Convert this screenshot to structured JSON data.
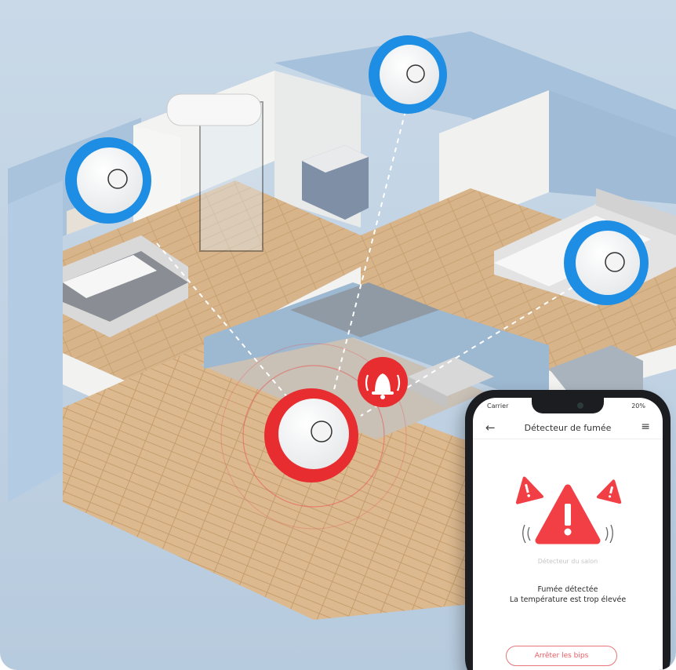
{
  "scene": {
    "image_subject": "smart-home-smoke-detectors",
    "colors": {
      "alert_red": "#e72d2f",
      "sensor_blue": "#1d8ee3",
      "wall_blue": "#a8c4df",
      "floor_wood": "#d7b389"
    },
    "detectors": [
      {
        "room": "bedroom-left",
        "status": "normal",
        "color": "blue"
      },
      {
        "room": "bathroom-bedroom",
        "status": "normal",
        "color": "blue"
      },
      {
        "room": "bedroom-right",
        "status": "normal",
        "color": "blue"
      },
      {
        "room": "living-room",
        "status": "alarm",
        "color": "red"
      }
    ],
    "alarm_icon": "bell-icon"
  },
  "phone": {
    "status": {
      "carrier": "Carrier",
      "battery": "20%"
    },
    "header": {
      "title": "Détecteur de fumée",
      "back_icon": "back-arrow-icon",
      "menu_icon": "menu-icon"
    },
    "alert": {
      "icon": "warning-triangle-icon",
      "detector_name": "Détecteur du salon",
      "line1": "Fumée détectée",
      "line2": "La température est trop élevée"
    },
    "stop_button": "Arrêter les bips"
  }
}
